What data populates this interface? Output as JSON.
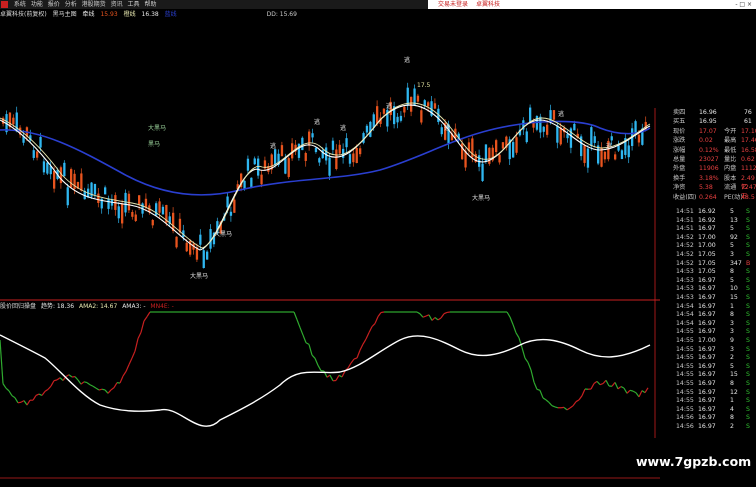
{
  "menu": {
    "items": [
      "系统",
      "功能",
      "报价",
      "分析",
      "港股期货",
      "资讯",
      "工具",
      "帮助"
    ]
  },
  "top_links": [
    "交易未登录",
    "卓翼科技"
  ],
  "window_controls": "- □ ×",
  "info": {
    "title": "卓翼科技(前复权)",
    "indicator": "黑马主图",
    "labels": [
      "牵线",
      "15.93",
      "橙线",
      "16.38",
      "蓝线",
      "",
      "DD: 15.69"
    ]
  },
  "chart_labels": {
    "sell": [
      "逃",
      "逃",
      "逃",
      "逃",
      "逃",
      "逃",
      "逃",
      "逃"
    ],
    "buy": [
      "大黑马",
      "黑马",
      "大黑马",
      "大黑马",
      "大黑马"
    ],
    "price_hi": "17.5"
  },
  "lower": {
    "name": "股价回归操盘",
    "items": [
      "趋势: 18.36",
      "AMA2: 14.67",
      "AMA3: -",
      "MN4E: -"
    ]
  },
  "quote_panel": {
    "rows": [
      {
        "l": "卖四",
        "v": "16.96",
        "r": "76"
      },
      {
        "l": "买五",
        "v": "16.95",
        "r": "61"
      },
      {
        "l": "现价",
        "v": "17.07",
        "m": "今开",
        "mv": "17.10"
      },
      {
        "l": "涨跌",
        "v": "0.02",
        "m": "最高",
        "mv": "17.46"
      },
      {
        "l": "涨幅",
        "v": "0.12%",
        "m": "最低",
        "mv": "16.58"
      },
      {
        "l": "总量",
        "v": "23027",
        "m": "量比",
        "mv": "0.62"
      },
      {
        "l": "外盘",
        "v": "11906",
        "m": "内盘",
        "mv": "11121"
      },
      {
        "l": "换手",
        "v": "3.18%",
        "m": "股本",
        "mv": "2.49亿"
      },
      {
        "l": "净资",
        "v": "5.38",
        "m": "流通",
        "mv": "7247万"
      },
      {
        "l": "收益(四)",
        "v": "0.264",
        "m": "PE(动)",
        "mv": "48.5"
      }
    ],
    "ticks": [
      {
        "t": "14:51",
        "p": "16.92",
        "v": "5",
        "d": "S"
      },
      {
        "t": "14:51",
        "p": "16.92",
        "v": "13",
        "d": "S"
      },
      {
        "t": "14:51",
        "p": "16.97",
        "v": "5",
        "d": "S"
      },
      {
        "t": "14:52",
        "p": "17.00",
        "v": "92",
        "d": "S"
      },
      {
        "t": "14:52",
        "p": "17.00",
        "v": "5",
        "d": "S"
      },
      {
        "t": "14:52",
        "p": "17.05",
        "v": "3",
        "d": "S"
      },
      {
        "t": "14:52",
        "p": "17.05",
        "v": "347",
        "d": "B"
      },
      {
        "t": "14:53",
        "p": "17.05",
        "v": "8",
        "d": "S"
      },
      {
        "t": "14:53",
        "p": "16.97",
        "v": "5",
        "d": "S"
      },
      {
        "t": "14:53",
        "p": "16.97",
        "v": "10",
        "d": "S"
      },
      {
        "t": "14:53",
        "p": "16.97",
        "v": "15",
        "d": "S"
      },
      {
        "t": "14:54",
        "p": "16.97",
        "v": "1",
        "d": "S"
      },
      {
        "t": "14:54",
        "p": "16.97",
        "v": "8",
        "d": "S"
      },
      {
        "t": "14:54",
        "p": "16.97",
        "v": "3",
        "d": "S"
      },
      {
        "t": "14:55",
        "p": "16.97",
        "v": "3",
        "d": "S"
      },
      {
        "t": "14:55",
        "p": "17.00",
        "v": "9",
        "d": "S"
      },
      {
        "t": "14:55",
        "p": "16.97",
        "v": "3",
        "d": "S"
      },
      {
        "t": "14:55",
        "p": "16.97",
        "v": "2",
        "d": "S"
      },
      {
        "t": "14:55",
        "p": "16.97",
        "v": "5",
        "d": "S"
      },
      {
        "t": "14:55",
        "p": "16.97",
        "v": "15",
        "d": "S"
      },
      {
        "t": "14:55",
        "p": "16.97",
        "v": "8",
        "d": "S"
      },
      {
        "t": "14:55",
        "p": "16.97",
        "v": "12",
        "d": "S"
      },
      {
        "t": "14:55",
        "p": "16.97",
        "v": "1",
        "d": "S"
      },
      {
        "t": "14:55",
        "p": "16.97",
        "v": "4",
        "d": "S"
      },
      {
        "t": "14:56",
        "p": "16.97",
        "v": "8",
        "d": "S"
      },
      {
        "t": "14:56",
        "p": "16.97",
        "v": "2",
        "d": "S"
      }
    ]
  },
  "watermark": "www.7gpzb.com",
  "colors": {
    "up": "#e8541e",
    "down": "#2fb6f0",
    "ma_blue": "#2a3fd0",
    "white": "#ffffff",
    "yellow": "#e8e8b0",
    "green": "#2faa2f",
    "red": "#c82020",
    "label": "#e0e0a0"
  }
}
